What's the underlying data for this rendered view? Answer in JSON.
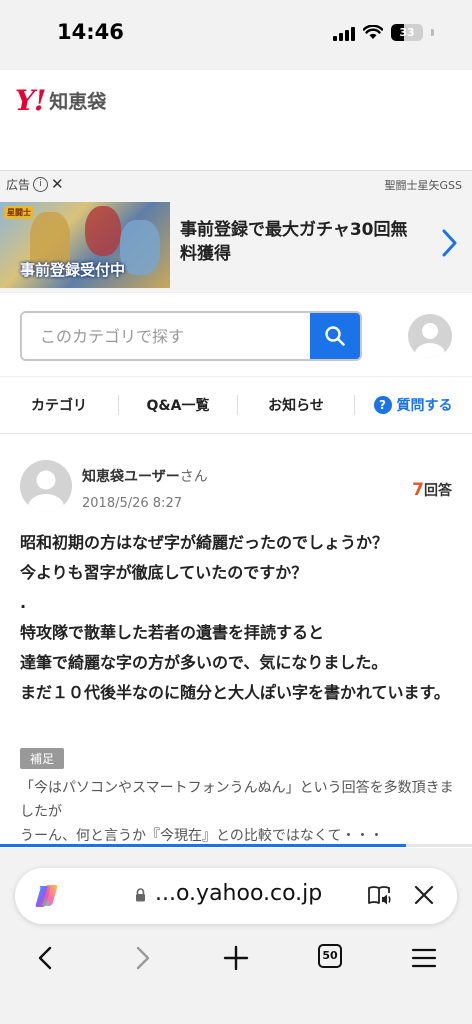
{
  "status_bar": {
    "time": "14:46",
    "battery": "33"
  },
  "header": {
    "logo_mark": "Y!",
    "logo_text": "知恵袋"
  },
  "ad": {
    "label": "広告",
    "sponsor": "聖闘士星矢GSS",
    "image_caption": "事前登録受付中",
    "image_badge": "星闘士",
    "title": "事前登録で最大ガチャ30回無料獲得"
  },
  "search": {
    "placeholder": "このカテゴリで探す"
  },
  "nav": {
    "items": [
      {
        "label": "カテゴリ"
      },
      {
        "label": "Q&A一覧"
      },
      {
        "label": "お知らせ"
      },
      {
        "label": "質問する"
      }
    ]
  },
  "question": {
    "user": "知恵袋ユーザー",
    "honorific": "さん",
    "date": "2018/5/26 8:27",
    "answer_count": "7",
    "answer_label": "回答",
    "body": "昭和初期の方はなぜ字が綺麗だったのでしょうか？\n今よりも習字が徹底していたのですか？\n.\n特攻隊で散華した若者の遺書を拝読すると\n達筆で綺麗な字の方が多いので、気になりました。\nまだ１０代後半なのに随分と大人ぽい字を書かれています。",
    "supplement_label": "補足",
    "supplement": "「今はパソコンやスマートフォンうんぬん」という回答を多数頂きましたが\nうーん、何と言うか『今現在』との比較ではなくて・・・",
    "scroll_progress": 0.86
  },
  "browser": {
    "url": "...o.yahoo.co.jp",
    "tabs_count": "50"
  },
  "colors": {
    "accent": "#1a73e8",
    "brand_red": "#e60033",
    "answer_count": "#e8552a"
  }
}
